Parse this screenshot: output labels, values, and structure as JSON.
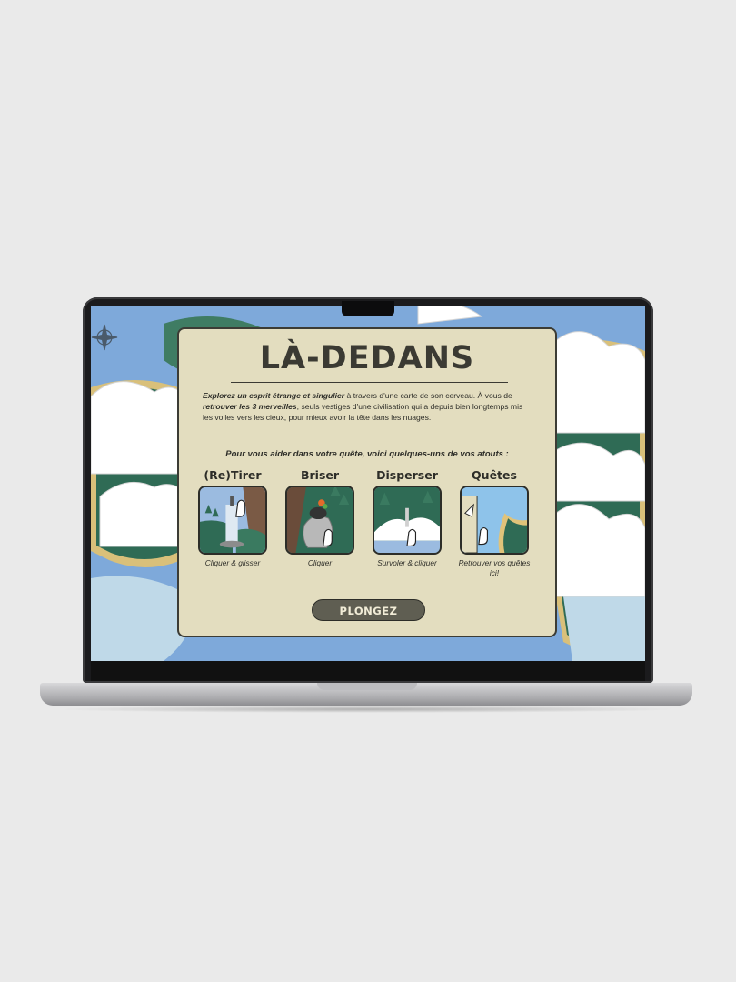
{
  "app": {
    "title": "LÀ-DEDANS",
    "intro_part1": "Explorez un esprit étrange et singulier",
    "intro_part2": " à travers d'une carte de son cerveau. À vous de ",
    "intro_part3": "retrouver les 3 merveilles",
    "intro_part4": ", seuls vestiges d'une civilisation qui a depuis bien longtemps mis les voiles vers les cieux, pour mieux avoir la tête dans les nuages.",
    "subtitle": "Pour vous aider dans votre quête, voici quelques-uns de vos atouts :",
    "cta_label": "PLONGEZ"
  },
  "cards": [
    {
      "title": "(Re)Tirer",
      "caption": "Cliquer & glisser",
      "icon": "sword-pull-icon"
    },
    {
      "title": "Briser",
      "caption": "Cliquer",
      "icon": "rock-smash-icon"
    },
    {
      "title": "Disperser",
      "caption": "Survoler & cliquer",
      "icon": "cloud-disperse-icon"
    },
    {
      "title": "Quêtes",
      "caption": "Retrouver vos quêtes ici!",
      "icon": "quest-map-icon"
    }
  ],
  "colors": {
    "panel": "#e3ddbf",
    "ink": "#2d2d28",
    "button": "#5f5e52",
    "sky": "#7aa6d8",
    "land": "#2f6b55"
  }
}
